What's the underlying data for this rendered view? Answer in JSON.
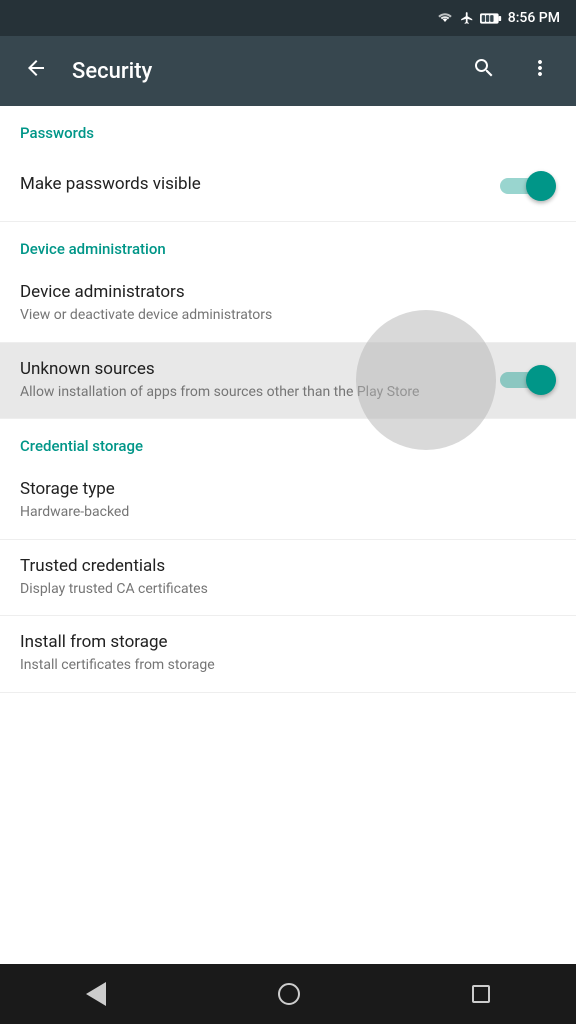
{
  "statusBar": {
    "time": "8:56 PM"
  },
  "appBar": {
    "title": "Security",
    "backLabel": "back",
    "searchLabel": "search",
    "moreLabel": "more options"
  },
  "sections": [
    {
      "id": "passwords",
      "header": "Passwords",
      "items": [
        {
          "id": "make-passwords-visible",
          "title": "Make passwords visible",
          "subtitle": "",
          "hasToggle": true,
          "toggleOn": true,
          "highlighted": false
        }
      ]
    },
    {
      "id": "device-administration",
      "header": "Device administration",
      "items": [
        {
          "id": "device-administrators",
          "title": "Device administrators",
          "subtitle": "View or deactivate device administrators",
          "hasToggle": false,
          "highlighted": false
        },
        {
          "id": "unknown-sources",
          "title": "Unknown sources",
          "subtitle": "Allow installation of apps from sources other than the Play Store",
          "hasToggle": true,
          "toggleOn": true,
          "highlighted": true
        }
      ]
    },
    {
      "id": "credential-storage",
      "header": "Credential storage",
      "items": [
        {
          "id": "storage-type",
          "title": "Storage type",
          "subtitle": "Hardware-backed",
          "hasToggle": false,
          "highlighted": false
        },
        {
          "id": "trusted-credentials",
          "title": "Trusted credentials",
          "subtitle": "Display trusted CA certificates",
          "hasToggle": false,
          "highlighted": false
        },
        {
          "id": "install-from-storage",
          "title": "Install from storage",
          "subtitle": "Install certificates from storage",
          "hasToggle": false,
          "highlighted": false
        }
      ]
    }
  ],
  "navBar": {
    "back": "back",
    "home": "home",
    "recents": "recents"
  }
}
